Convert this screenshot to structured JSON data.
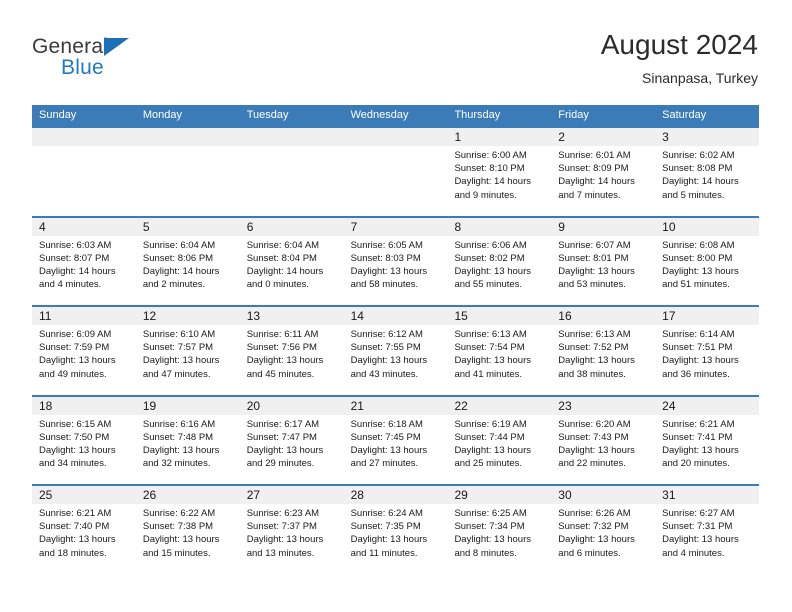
{
  "brand": {
    "word_one": "General",
    "word_two": "Blue",
    "triangle_color": "#1f6fb8",
    "blue_color": "#1f7ac4",
    "gray_color": "#3b3b3b"
  },
  "header": {
    "title": "August 2024",
    "subtitle": "Sinanpasa, Turkey"
  },
  "colors": {
    "header_blue": "#3b7cb8",
    "day_band_gray": "#f0f0f0",
    "text": "#1a1a1a"
  },
  "weekdays": [
    "Sunday",
    "Monday",
    "Tuesday",
    "Wednesday",
    "Thursday",
    "Friday",
    "Saturday"
  ],
  "weeks": [
    [
      {
        "day": "",
        "sunrise": "",
        "sunset": "",
        "daylight_line1": "",
        "daylight_line2": ""
      },
      {
        "day": "",
        "sunrise": "",
        "sunset": "",
        "daylight_line1": "",
        "daylight_line2": ""
      },
      {
        "day": "",
        "sunrise": "",
        "sunset": "",
        "daylight_line1": "",
        "daylight_line2": ""
      },
      {
        "day": "",
        "sunrise": "",
        "sunset": "",
        "daylight_line1": "",
        "daylight_line2": ""
      },
      {
        "day": "1",
        "sunrise": "Sunrise: 6:00 AM",
        "sunset": "Sunset: 8:10 PM",
        "daylight_line1": "Daylight: 14 hours",
        "daylight_line2": "and 9 minutes."
      },
      {
        "day": "2",
        "sunrise": "Sunrise: 6:01 AM",
        "sunset": "Sunset: 8:09 PM",
        "daylight_line1": "Daylight: 14 hours",
        "daylight_line2": "and 7 minutes."
      },
      {
        "day": "3",
        "sunrise": "Sunrise: 6:02 AM",
        "sunset": "Sunset: 8:08 PM",
        "daylight_line1": "Daylight: 14 hours",
        "daylight_line2": "and 5 minutes."
      }
    ],
    [
      {
        "day": "4",
        "sunrise": "Sunrise: 6:03 AM",
        "sunset": "Sunset: 8:07 PM",
        "daylight_line1": "Daylight: 14 hours",
        "daylight_line2": "and 4 minutes."
      },
      {
        "day": "5",
        "sunrise": "Sunrise: 6:04 AM",
        "sunset": "Sunset: 8:06 PM",
        "daylight_line1": "Daylight: 14 hours",
        "daylight_line2": "and 2 minutes."
      },
      {
        "day": "6",
        "sunrise": "Sunrise: 6:04 AM",
        "sunset": "Sunset: 8:04 PM",
        "daylight_line1": "Daylight: 14 hours",
        "daylight_line2": "and 0 minutes."
      },
      {
        "day": "7",
        "sunrise": "Sunrise: 6:05 AM",
        "sunset": "Sunset: 8:03 PM",
        "daylight_line1": "Daylight: 13 hours",
        "daylight_line2": "and 58 minutes."
      },
      {
        "day": "8",
        "sunrise": "Sunrise: 6:06 AM",
        "sunset": "Sunset: 8:02 PM",
        "daylight_line1": "Daylight: 13 hours",
        "daylight_line2": "and 55 minutes."
      },
      {
        "day": "9",
        "sunrise": "Sunrise: 6:07 AM",
        "sunset": "Sunset: 8:01 PM",
        "daylight_line1": "Daylight: 13 hours",
        "daylight_line2": "and 53 minutes."
      },
      {
        "day": "10",
        "sunrise": "Sunrise: 6:08 AM",
        "sunset": "Sunset: 8:00 PM",
        "daylight_line1": "Daylight: 13 hours",
        "daylight_line2": "and 51 minutes."
      }
    ],
    [
      {
        "day": "11",
        "sunrise": "Sunrise: 6:09 AM",
        "sunset": "Sunset: 7:59 PM",
        "daylight_line1": "Daylight: 13 hours",
        "daylight_line2": "and 49 minutes."
      },
      {
        "day": "12",
        "sunrise": "Sunrise: 6:10 AM",
        "sunset": "Sunset: 7:57 PM",
        "daylight_line1": "Daylight: 13 hours",
        "daylight_line2": "and 47 minutes."
      },
      {
        "day": "13",
        "sunrise": "Sunrise: 6:11 AM",
        "sunset": "Sunset: 7:56 PM",
        "daylight_line1": "Daylight: 13 hours",
        "daylight_line2": "and 45 minutes."
      },
      {
        "day": "14",
        "sunrise": "Sunrise: 6:12 AM",
        "sunset": "Sunset: 7:55 PM",
        "daylight_line1": "Daylight: 13 hours",
        "daylight_line2": "and 43 minutes."
      },
      {
        "day": "15",
        "sunrise": "Sunrise: 6:13 AM",
        "sunset": "Sunset: 7:54 PM",
        "daylight_line1": "Daylight: 13 hours",
        "daylight_line2": "and 41 minutes."
      },
      {
        "day": "16",
        "sunrise": "Sunrise: 6:13 AM",
        "sunset": "Sunset: 7:52 PM",
        "daylight_line1": "Daylight: 13 hours",
        "daylight_line2": "and 38 minutes."
      },
      {
        "day": "17",
        "sunrise": "Sunrise: 6:14 AM",
        "sunset": "Sunset: 7:51 PM",
        "daylight_line1": "Daylight: 13 hours",
        "daylight_line2": "and 36 minutes."
      }
    ],
    [
      {
        "day": "18",
        "sunrise": "Sunrise: 6:15 AM",
        "sunset": "Sunset: 7:50 PM",
        "daylight_line1": "Daylight: 13 hours",
        "daylight_line2": "and 34 minutes."
      },
      {
        "day": "19",
        "sunrise": "Sunrise: 6:16 AM",
        "sunset": "Sunset: 7:48 PM",
        "daylight_line1": "Daylight: 13 hours",
        "daylight_line2": "and 32 minutes."
      },
      {
        "day": "20",
        "sunrise": "Sunrise: 6:17 AM",
        "sunset": "Sunset: 7:47 PM",
        "daylight_line1": "Daylight: 13 hours",
        "daylight_line2": "and 29 minutes."
      },
      {
        "day": "21",
        "sunrise": "Sunrise: 6:18 AM",
        "sunset": "Sunset: 7:45 PM",
        "daylight_line1": "Daylight: 13 hours",
        "daylight_line2": "and 27 minutes."
      },
      {
        "day": "22",
        "sunrise": "Sunrise: 6:19 AM",
        "sunset": "Sunset: 7:44 PM",
        "daylight_line1": "Daylight: 13 hours",
        "daylight_line2": "and 25 minutes."
      },
      {
        "day": "23",
        "sunrise": "Sunrise: 6:20 AM",
        "sunset": "Sunset: 7:43 PM",
        "daylight_line1": "Daylight: 13 hours",
        "daylight_line2": "and 22 minutes."
      },
      {
        "day": "24",
        "sunrise": "Sunrise: 6:21 AM",
        "sunset": "Sunset: 7:41 PM",
        "daylight_line1": "Daylight: 13 hours",
        "daylight_line2": "and 20 minutes."
      }
    ],
    [
      {
        "day": "25",
        "sunrise": "Sunrise: 6:21 AM",
        "sunset": "Sunset: 7:40 PM",
        "daylight_line1": "Daylight: 13 hours",
        "daylight_line2": "and 18 minutes."
      },
      {
        "day": "26",
        "sunrise": "Sunrise: 6:22 AM",
        "sunset": "Sunset: 7:38 PM",
        "daylight_line1": "Daylight: 13 hours",
        "daylight_line2": "and 15 minutes."
      },
      {
        "day": "27",
        "sunrise": "Sunrise: 6:23 AM",
        "sunset": "Sunset: 7:37 PM",
        "daylight_line1": "Daylight: 13 hours",
        "daylight_line2": "and 13 minutes."
      },
      {
        "day": "28",
        "sunrise": "Sunrise: 6:24 AM",
        "sunset": "Sunset: 7:35 PM",
        "daylight_line1": "Daylight: 13 hours",
        "daylight_line2": "and 11 minutes."
      },
      {
        "day": "29",
        "sunrise": "Sunrise: 6:25 AM",
        "sunset": "Sunset: 7:34 PM",
        "daylight_line1": "Daylight: 13 hours",
        "daylight_line2": "and 8 minutes."
      },
      {
        "day": "30",
        "sunrise": "Sunrise: 6:26 AM",
        "sunset": "Sunset: 7:32 PM",
        "daylight_line1": "Daylight: 13 hours",
        "daylight_line2": "and 6 minutes."
      },
      {
        "day": "31",
        "sunrise": "Sunrise: 6:27 AM",
        "sunset": "Sunset: 7:31 PM",
        "daylight_line1": "Daylight: 13 hours",
        "daylight_line2": "and 4 minutes."
      }
    ]
  ]
}
